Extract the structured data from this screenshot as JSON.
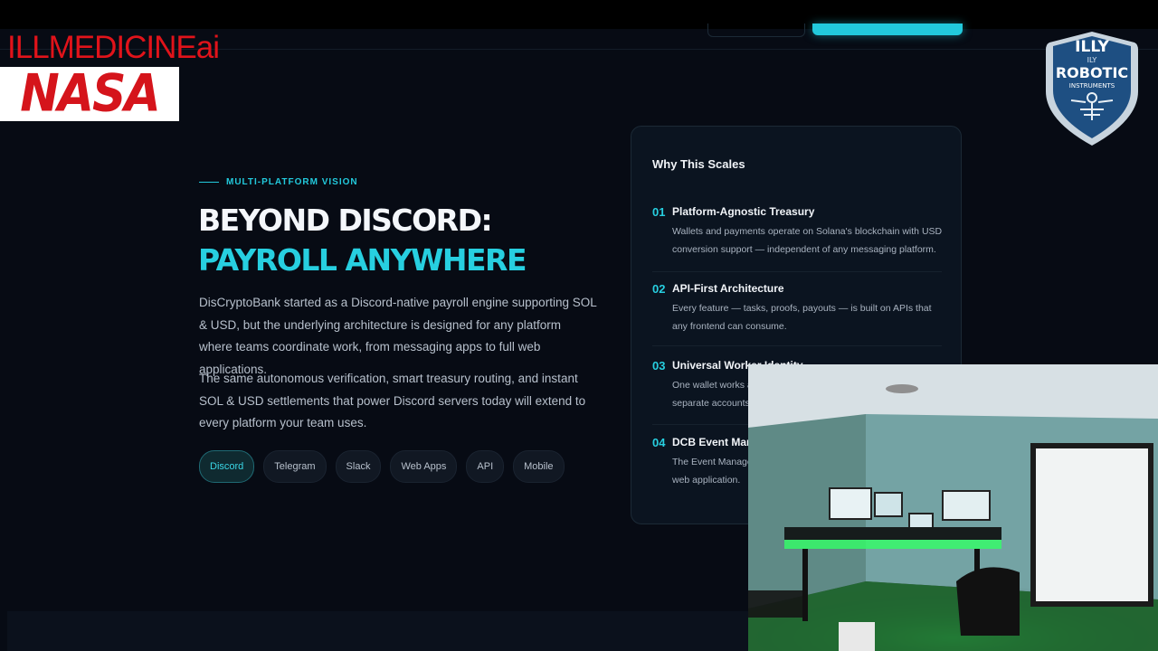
{
  "overlay": {
    "brand_title": "ILLMEDICINEai",
    "nasa_logo": "NASA",
    "badge_top": "ILLY",
    "badge_small": "ILY",
    "badge_main": "ROBOTIC",
    "badge_sub": "INSTRUMENTS"
  },
  "hero": {
    "eyebrow": "MULTI-PLATFORM VISION",
    "title_line1": "BEYOND DISCORD:",
    "title_line2": "PAYROLL ANYWHERE",
    "paragraph1": "DisCryptoBank started as a Discord-native payroll engine supporting SOL & USD, but the underlying architecture is designed for any platform where teams coordinate work, from messaging apps to full web applications.",
    "paragraph2": "The same autonomous verification, smart treasury routing, and instant SOL & USD settlements that power Discord servers today will extend to every platform your team uses.",
    "platforms": [
      "Discord",
      "Telegram",
      "Slack",
      "Web Apps",
      "API",
      "Mobile"
    ],
    "active_platform": "Discord"
  },
  "scales_card": {
    "title": "Why This Scales",
    "items": [
      {
        "num": "01",
        "title": "Platform-Agnostic Treasury",
        "desc": "Wallets and payments operate on Solana's blockchain with USD conversion support — independent of any messaging platform."
      },
      {
        "num": "02",
        "title": "API-First Architecture",
        "desc": "Every feature — tasks, proofs, payouts — is built on APIs that any frontend can consume."
      },
      {
        "num": "03",
        "title": "Universal Worker Identity",
        "desc": "One wallet works across every platform — workers don't need separate accounts."
      },
      {
        "num": "04",
        "title": "DCB Event Manager",
        "desc": "The Event Manager extends beyond Discord as a standalone web application."
      }
    ]
  },
  "colors": {
    "accent": "#27cfe0",
    "background": "#070b14",
    "card_bg": "#0b1420",
    "nasa_red": "#d5141b"
  }
}
